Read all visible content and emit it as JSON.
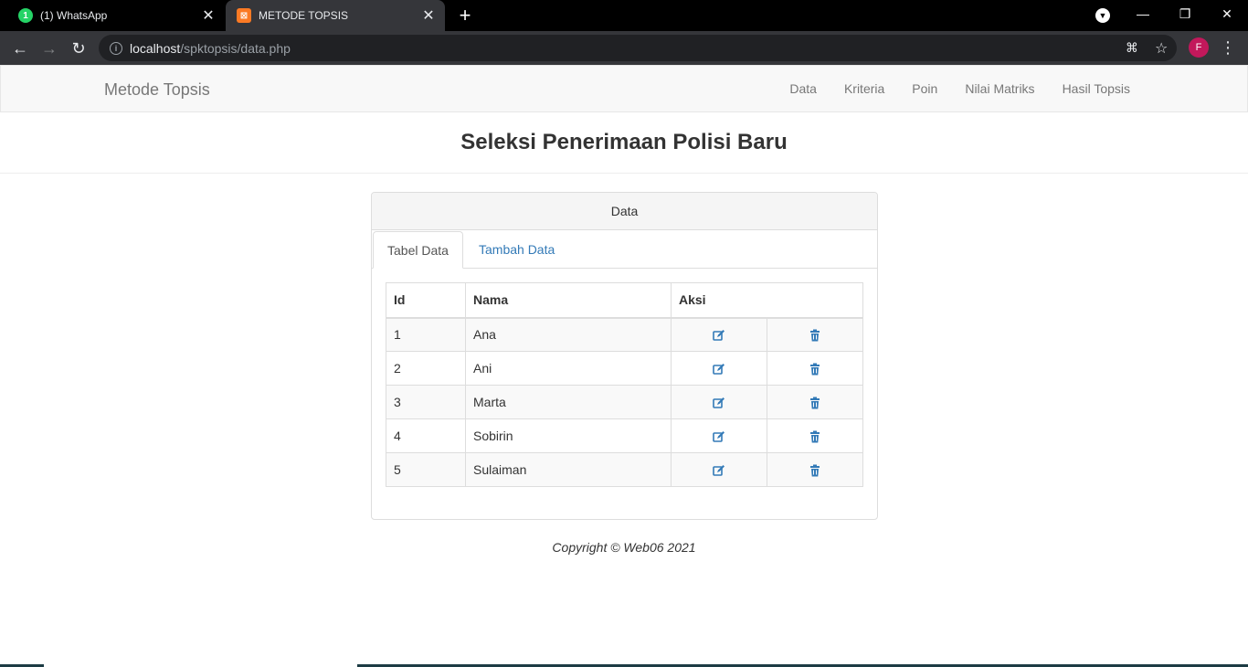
{
  "browser": {
    "tabs": [
      {
        "title": "(1) WhatsApp",
        "favicon": "whatsapp-icon"
      },
      {
        "title": "METODE TOPSIS",
        "favicon": "xampp-icon"
      }
    ],
    "url_host": "localhost",
    "url_path": "/spktopsis/data.php",
    "profile_initial": "F"
  },
  "navbar": {
    "brand": "Metode Topsis",
    "links": [
      "Data",
      "Kriteria",
      "Poin",
      "Nilai Matriks",
      "Hasil Topsis"
    ]
  },
  "header": {
    "title": "Seleksi Penerimaan Polisi Baru"
  },
  "panel": {
    "heading": "Data",
    "tabs": [
      "Tabel Data",
      "Tambah Data"
    ],
    "table": {
      "columns": [
        "Id",
        "Nama",
        "Aksi"
      ],
      "rows": [
        {
          "id": "1",
          "nama": "Ana"
        },
        {
          "id": "2",
          "nama": "Ani"
        },
        {
          "id": "3",
          "nama": "Marta"
        },
        {
          "id": "4",
          "nama": "Sobirin"
        },
        {
          "id": "5",
          "nama": "Sulaiman"
        }
      ],
      "actions": [
        "edit-icon",
        "trash-icon"
      ]
    }
  },
  "footer": {
    "text": "Copyright © Web06 2021"
  },
  "colors": {
    "link": "#337ab7",
    "navbar_bg": "#f8f8f8",
    "chrome_toolbar": "#35363a"
  }
}
